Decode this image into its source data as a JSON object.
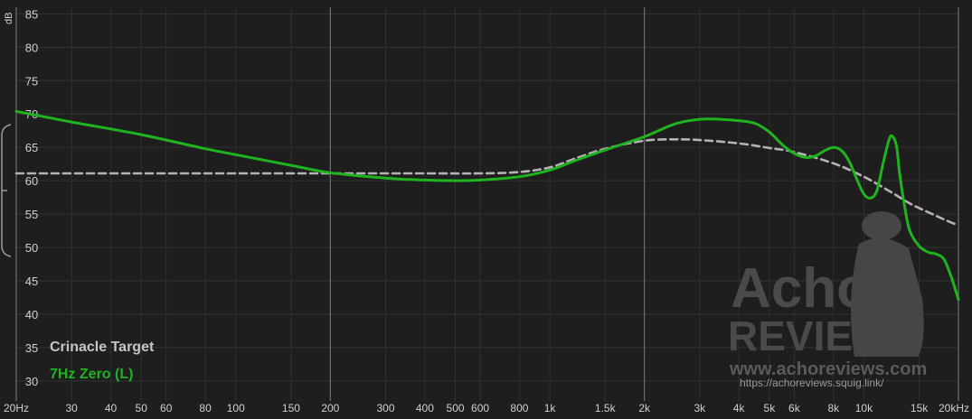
{
  "chart_data": {
    "type": "line",
    "ylabel": "dB",
    "ylim": [
      27,
      86
    ],
    "yticks": [
      30,
      35,
      40,
      45,
      50,
      55,
      60,
      65,
      70,
      75,
      80,
      85
    ],
    "xscale": "log",
    "xlim": [
      20,
      20000
    ],
    "xticks": [
      {
        "v": 20,
        "label": "20Hz"
      },
      {
        "v": 30,
        "label": "30"
      },
      {
        "v": 40,
        "label": "40"
      },
      {
        "v": 50,
        "label": "50"
      },
      {
        "v": 60,
        "label": "60"
      },
      {
        "v": 80,
        "label": "80"
      },
      {
        "v": 100,
        "label": "100"
      },
      {
        "v": 150,
        "label": "150"
      },
      {
        "v": 200,
        "label": "200"
      },
      {
        "v": 300,
        "label": "300"
      },
      {
        "v": 400,
        "label": "400"
      },
      {
        "v": 500,
        "label": "500"
      },
      {
        "v": 600,
        "label": "600"
      },
      {
        "v": 800,
        "label": "800"
      },
      {
        "v": 1000,
        "label": "1k"
      },
      {
        "v": 1500,
        "label": "1.5k"
      },
      {
        "v": 2000,
        "label": "2k"
      },
      {
        "v": 3000,
        "label": "3k"
      },
      {
        "v": 4000,
        "label": "4k"
      },
      {
        "v": 5000,
        "label": "5k"
      },
      {
        "v": 6000,
        "label": "6k"
      },
      {
        "v": 8000,
        "label": "8k"
      },
      {
        "v": 10000,
        "label": "10k"
      },
      {
        "v": 15000,
        "label": "15k"
      },
      {
        "v": 20000,
        "label": "20kHz"
      }
    ],
    "major_grid": [
      20,
      200,
      2000,
      20000
    ],
    "series": [
      {
        "name": "Crinacle Target",
        "color": "#b8b0b8",
        "dashed": true,
        "points": [
          [
            20,
            61.1
          ],
          [
            50,
            61.1
          ],
          [
            100,
            61.1
          ],
          [
            200,
            61.1
          ],
          [
            400,
            61.1
          ],
          [
            600,
            61.1
          ],
          [
            800,
            61.3
          ],
          [
            1000,
            62.0
          ],
          [
            1200,
            63.3
          ],
          [
            1500,
            64.8
          ],
          [
            2000,
            66.0
          ],
          [
            2500,
            66.2
          ],
          [
            3000,
            66.1
          ],
          [
            4000,
            65.6
          ],
          [
            5000,
            64.9
          ],
          [
            6000,
            64.3
          ],
          [
            8000,
            62.6
          ],
          [
            10000,
            60.6
          ],
          [
            12000,
            58.5
          ],
          [
            14000,
            56.6
          ],
          [
            16000,
            55.3
          ],
          [
            18000,
            54.2
          ],
          [
            20000,
            53.3
          ]
        ]
      },
      {
        "name": "7Hz Zero (L)",
        "color": "#1fb31f",
        "dashed": false,
        "points": [
          [
            20,
            70.4
          ],
          [
            30,
            68.8
          ],
          [
            50,
            66.9
          ],
          [
            80,
            64.8
          ],
          [
            100,
            63.9
          ],
          [
            150,
            62.3
          ],
          [
            200,
            61.2
          ],
          [
            300,
            60.4
          ],
          [
            400,
            60.1
          ],
          [
            500,
            60.0
          ],
          [
            600,
            60.1
          ],
          [
            800,
            60.6
          ],
          [
            1000,
            61.6
          ],
          [
            1200,
            63.0
          ],
          [
            1500,
            64.6
          ],
          [
            2000,
            66.6
          ],
          [
            2500,
            68.5
          ],
          [
            3000,
            69.2
          ],
          [
            3500,
            69.2
          ],
          [
            4000,
            69.0
          ],
          [
            4500,
            68.6
          ],
          [
            5000,
            67.3
          ],
          [
            5500,
            65.4
          ],
          [
            6000,
            64.1
          ],
          [
            6500,
            63.5
          ],
          [
            7000,
            63.7
          ],
          [
            7500,
            64.5
          ],
          [
            8000,
            65.0
          ],
          [
            8500,
            64.5
          ],
          [
            9000,
            62.8
          ],
          [
            9500,
            60.2
          ],
          [
            10000,
            58.0
          ],
          [
            10500,
            57.4
          ],
          [
            11000,
            58.5
          ],
          [
            11500,
            62.5
          ],
          [
            12000,
            66.0
          ],
          [
            12300,
            66.7
          ],
          [
            12700,
            65.2
          ],
          [
            13000,
            61.0
          ],
          [
            13500,
            56.0
          ],
          [
            14000,
            52.5
          ],
          [
            15000,
            50.2
          ],
          [
            16000,
            49.3
          ],
          [
            17000,
            49.0
          ],
          [
            18000,
            48.2
          ],
          [
            19000,
            45.5
          ],
          [
            20000,
            42.2
          ]
        ]
      }
    ],
    "legend": {
      "placement": "bottom-left",
      "entries": [
        "Crinacle Target",
        "7Hz Zero (L)"
      ]
    }
  },
  "watermark": {
    "line1": "Acho",
    "line2": "REVIEWS",
    "url": "www.achoreviews.com",
    "sub": "https://achoreviews.squig.link/"
  }
}
